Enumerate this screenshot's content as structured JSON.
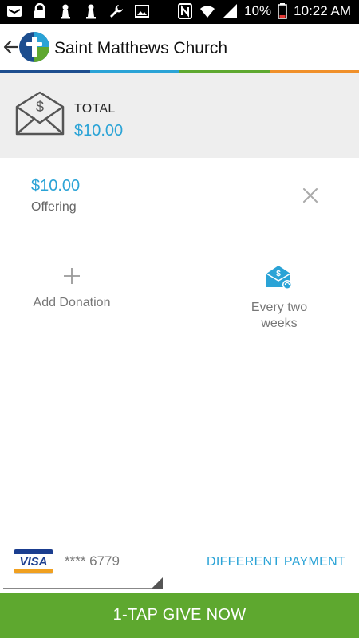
{
  "status_bar": {
    "battery": "10%",
    "time": "10:22 AM",
    "icons": [
      "email-icon",
      "lock-icon",
      "chess-pawn-icon",
      "chess-pawn-icon",
      "wrench-icon",
      "image-icon",
      "nfc-icon",
      "wifi-icon",
      "signal-icon",
      "battery-icon"
    ]
  },
  "app_bar": {
    "title": "Saint Matthews Church",
    "back_icon": "arrow-left-icon",
    "logo_icon": "church-logo-icon"
  },
  "colors": {
    "accent_blue": "#2aa3d6",
    "give_green": "#5ea82f",
    "stripe": [
      "#1d4e8f",
      "#2aa3d6",
      "#5ea82f",
      "#f0902a"
    ]
  },
  "total": {
    "label": "TOTAL",
    "amount": "$10.00"
  },
  "donation": {
    "amount": "$10.00",
    "fund": "Offering"
  },
  "actions": {
    "add_label": "Add Donation",
    "frequency_label": "Every two weeks"
  },
  "payment": {
    "card_brand": "VISA",
    "card_number": "**** 6779",
    "different_payment_label": "DIFFERENT PAYMENT"
  },
  "give_button": {
    "label": "1-TAP GIVE NOW"
  }
}
